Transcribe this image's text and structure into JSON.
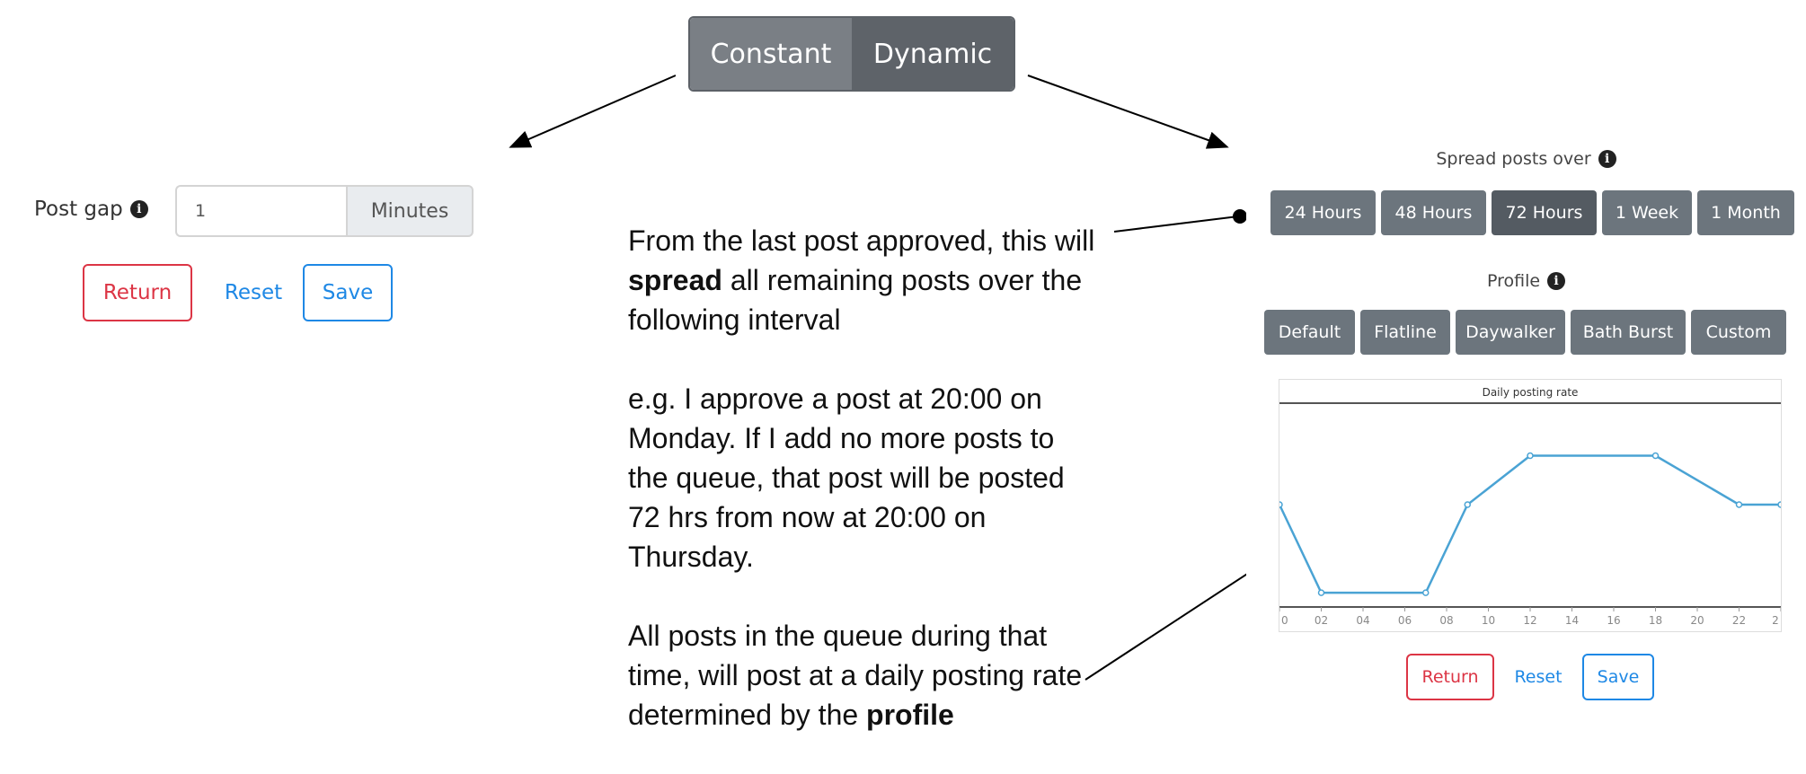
{
  "mode_toggle": {
    "constant_label": "Constant",
    "dynamic_label": "Dynamic",
    "selected": "Dynamic"
  },
  "constant_panel": {
    "post_gap_label": "Post gap",
    "post_gap_value": "1",
    "unit_label": "Minutes",
    "return_label": "Return",
    "reset_label": "Reset",
    "save_label": "Save"
  },
  "explanation": {
    "p1_a": "From the last post approved, this will ",
    "p1_bold": "spread",
    "p1_b": " all remaining posts over the following interval",
    "p2": "e.g. I approve a post at 20:00 on Monday. If I add no more posts to the queue, that post will be posted 72 hrs from now at 20:00 on Thursday.",
    "p3_a": "All posts in the queue during that time, will post at a daily posting rate determined by the ",
    "p3_bold": "profile"
  },
  "dynamic_panel": {
    "spread_label": "Spread posts over",
    "intervals": [
      "24 Hours",
      "48 Hours",
      "72 Hours",
      "1 Week",
      "1 Month"
    ],
    "selected_interval": "72 Hours",
    "profile_label": "Profile",
    "profiles": [
      "Default",
      "Flatline",
      "Daywalker",
      "Bath Burst",
      "Custom"
    ],
    "return_label": "Return",
    "reset_label": "Reset",
    "save_label": "Save"
  },
  "chart_data": {
    "type": "line",
    "title": "Daily posting rate",
    "xlabel": "",
    "ylabel": "",
    "x_ticks": [
      "0",
      "02",
      "04",
      "06",
      "08",
      "10",
      "12",
      "14",
      "16",
      "18",
      "20",
      "22",
      "2"
    ],
    "xlim": [
      0,
      24
    ],
    "ylim": [
      0,
      1
    ],
    "grid": false,
    "series": [
      {
        "x": [
          0,
          2,
          7,
          9,
          12,
          18,
          22,
          24
        ],
        "y": [
          0.5,
          0.05,
          0.05,
          0.5,
          0.75,
          0.75,
          0.5,
          0.5
        ],
        "color": "#4aa3d4"
      }
    ]
  },
  "colors": {
    "danger": "#dc3545",
    "primary": "#1e88e5",
    "secondary": "#6c757d",
    "secondary_active": "#545b62",
    "line": "#4aa3d4"
  }
}
